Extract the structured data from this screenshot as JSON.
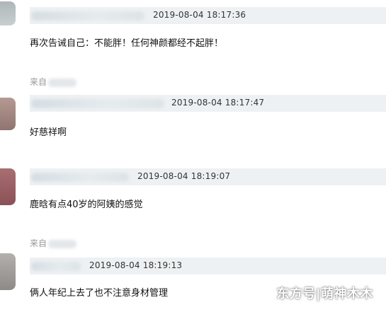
{
  "comments": [
    {
      "timestamp": "2019-08-04 18:17:36",
      "text": "再次告诫自己：不能胖！任何神颜都经不起胖！",
      "source": "来自"
    },
    {
      "timestamp": "2019-08-04 18:17:47",
      "text": "好慈祥啊",
      "source": ""
    },
    {
      "timestamp": "2019-08-04 18:19:07",
      "text": "鹿晗有点40岁的阿姨的感觉",
      "source": "来自"
    },
    {
      "timestamp": "2019-08-04 18:19:13",
      "text": "俩人年纪上去了也不注意身材管理",
      "source": ""
    }
  ],
  "watermark": "东方号|萌神木木",
  "colors": {
    "meta_bar": "#eef1f3",
    "source_text": "#999999"
  }
}
